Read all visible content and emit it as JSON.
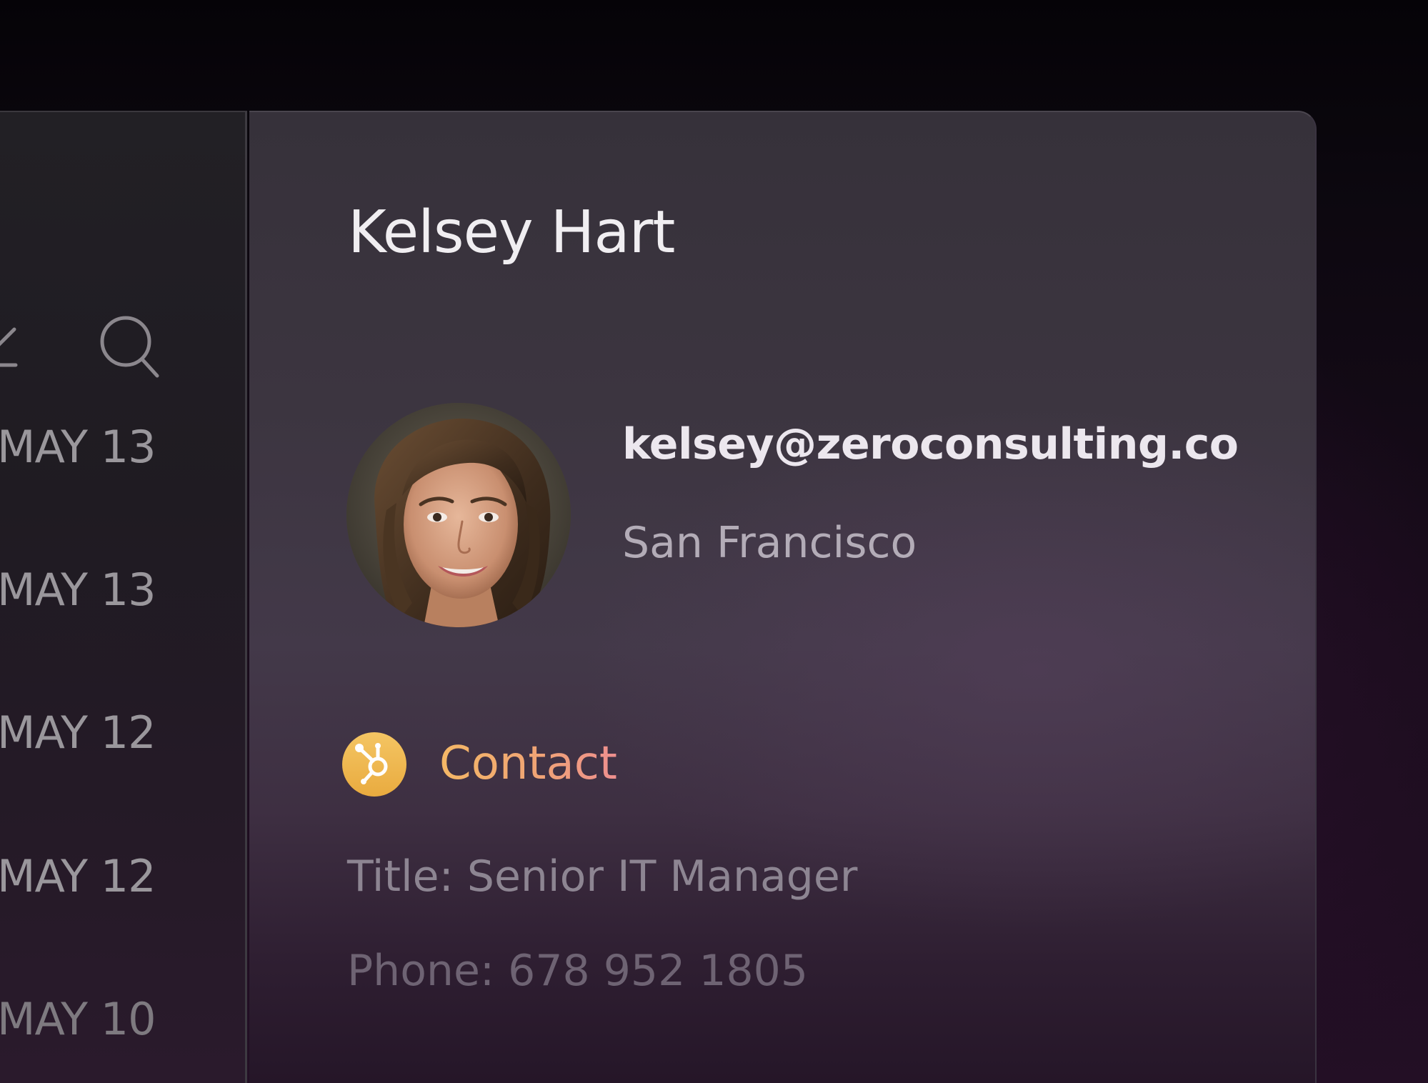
{
  "sidebar": {
    "icons": [
      "edit-icon",
      "search-icon"
    ],
    "dates": [
      "MAY 13",
      "MAY 13",
      "MAY 12",
      "MAY 12",
      "MAY 10"
    ]
  },
  "contact": {
    "name": "Kelsey Hart",
    "email": "kelsey@zeroconsulting.co",
    "location": "San Francisco",
    "section_label": "Contact",
    "section_icon": "hubspot-icon",
    "title_field": "Title: Senior IT Manager",
    "phone_field": "Phone: 678 952 1805"
  },
  "colors": {
    "accent_gradient_start": "#f4b866",
    "accent_gradient_end": "#ee8f8f",
    "badge": "#f0b84f"
  }
}
